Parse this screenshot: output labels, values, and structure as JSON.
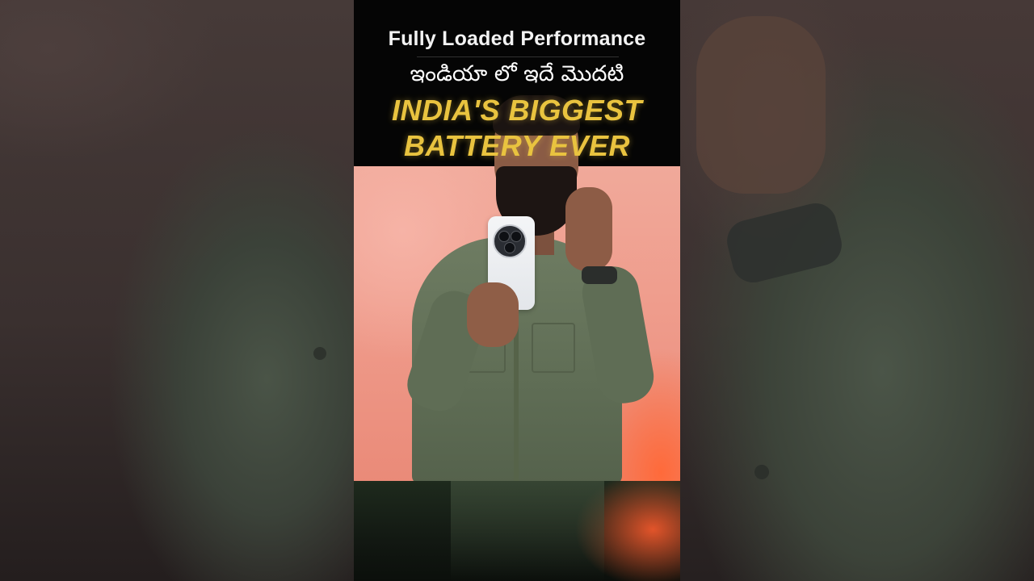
{
  "video": {
    "title_line": "Fully Loaded Performance",
    "telugu_line": "ఇండియా లో ఇదే మొదటి",
    "highlight_line_1": "INDIA'S BIGGEST",
    "highlight_line_2": "BATTERY EVER"
  },
  "colors": {
    "highlight": "#e9c33f",
    "backdrop": "#f0a99a",
    "shirt": "#6e7c62",
    "phone": "#f4f5f7"
  }
}
